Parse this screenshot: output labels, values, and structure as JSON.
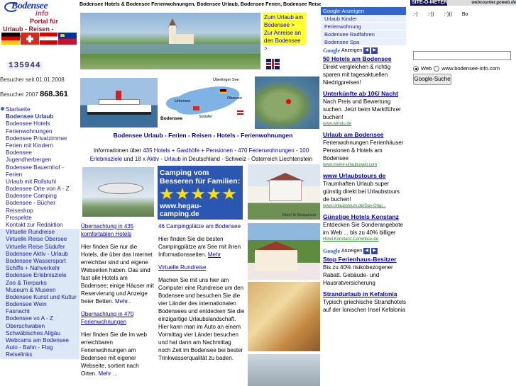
{
  "logo": {
    "line1": "Bodensee",
    "line2": "info",
    "line3": "Portal für",
    "line4": "Urlaub - Reisen - Freizeit"
  },
  "counter": "135944",
  "visitors_since": "Besucher seit 01.01.2008",
  "visitors_2007_label": "Besucher 2007",
  "visitors_2007_value": "868.361",
  "nav": [
    {
      "label": "Startseite",
      "bullet": true
    },
    {
      "label": "Bodensee Urlaub",
      "current": true
    },
    {
      "label": "Bodensee Hotels"
    },
    {
      "label": "Ferienwohnungen"
    },
    {
      "label": "Bodensee Privatzimmer"
    },
    {
      "label": "Ferien mit Kindern"
    },
    {
      "label": "Bodensee"
    },
    {
      "label": "Jugendherbergen"
    },
    {
      "label": "Bodensee Bauernhof -"
    },
    {
      "label": "  Ferien"
    },
    {
      "label": "Urlaub mit Rollstuhl"
    },
    {
      "label": "Bodensee Orte von A - Z"
    },
    {
      "label": "Bodensee Camping"
    },
    {
      "label": "Bodensee - Bücher"
    },
    {
      "label": "Reiseshop"
    },
    {
      "label": "Prospekte"
    },
    {
      "label": "Kontakt zur Redaktion"
    },
    {
      "label": "Virtuelle Rundreise",
      "alt": true
    },
    {
      "label": "Virtuelle Reise Obersee",
      "alt": true
    },
    {
      "label": "Virtuelle Reise Südufer",
      "alt": true
    },
    {
      "label": "Bodensee Aktiv - Urlaub",
      "alt": true
    },
    {
      "label": "Bodensee Wassersport",
      "alt": true
    },
    {
      "label": "Schiffe + Nahverkehr",
      "alt": true
    },
    {
      "label": "Bodensee Erlebnisziele",
      "alt": true
    },
    {
      "label": "Zoo & Tierparks",
      "alt": true
    },
    {
      "label": "Museum & Museen",
      "alt": true
    },
    {
      "label": "Bodensee Kunst und Kultur",
      "alt": true
    },
    {
      "label": "Bodensee Wein",
      "alt": true
    },
    {
      "label": "Fasnacht",
      "alt": true
    },
    {
      "label": "Bodensee vo A - Z",
      "alt": true
    },
    {
      "label": "Oberschwaben",
      "alt": true
    },
    {
      "label": "Schwäbisches Allgäu",
      "alt": true
    },
    {
      "label": "Webcams am Bodensee",
      "alt": true
    },
    {
      "label": "Auto - Bahn - Flug",
      "alt": true
    },
    {
      "label": "Reiselinks",
      "alt": true
    }
  ],
  "top_keywords": "Bodensee Hotels & Bodensee Ferienwohnungen, Bodensee Urlaub, Bodensee Ferien, Bodensee Reisen,",
  "yellow_box": {
    "a": "Zum Urlaub am Bodensee >",
    "b": "Zur Anreise an den Bodensee >"
  },
  "map_labels": {
    "ueberlinger": "Überlinger See",
    "obersee": "Obersee",
    "untersee": "Untersee",
    "suedufer": "Südufer",
    "bodensee": "Bodensee"
  },
  "tagline": "Bodensee Urlaub - Ferien - Reisen - Hotels - Ferienwohnungen",
  "intro": {
    "pre": "Informationen über",
    "link1": "435 Hotels + Gasthöfe + Pensionen - 470 Ferienwohnungen - 100 Erlebnisziele",
    "mid": "und",
    "link2": "18 x Aktiv - Urlaub",
    "post": "in Deutschland - Schweiz - Österreich Liechtenstein"
  },
  "camping_ad": {
    "headline": "Camping vom Besseren für Familien:",
    "url": "www.hegau-camping.de",
    "stars": 5
  },
  "col1": {
    "h1": "Übernachtung in 435 komfortablen Hotels",
    "t1": "Hier finden Sie nur die Hotels, die über das Internet erreichbar sind und eigene Webseiten haben. Das sind fast alle Hotels am Bodensee; einige Häuser mit Reservierung und Anzeige freier Betten.",
    "more1": "Mehr..",
    "h2": "Übernachtung in 470 Ferienwohnungen",
    "t2": "Hier finden Sie die im web erreichbaren Ferienwohnungen am Bodensee mit eigener Webseite, sortiert nach Orten.",
    "more2": "Mehr ..."
  },
  "col2": {
    "h1": "46 Campingplätze am Bodensee",
    "t1": "Hier finden Sie die besten Campingplätze am See mit ihren Informationsseiten.",
    "more1": "Mehr",
    "h2": "Virtuelle Rundreise",
    "t2": "Machen Sie mit uns hier am Computer eine Rundreise um den Bodensee und besuchen Sie die vier Länder des internationalen Bodensees und entdecken Sie die einzigartige Urlaubslandschaft. Hier kann man im Auto an einem Vormittag vier Länder besuchen und hat dann am Nachmittag noch Zeit im Bodensee bei bester Trinkwasserqualität zu baden."
  },
  "hotel_photo_caption": "Hotel & Restaurant",
  "google": {
    "header": "Google-Anzeigen",
    "links": [
      "Urlaub Kinder",
      "Ferienwohnung",
      "Bodensee Radfahren",
      "Bodensee Spa"
    ],
    "mark_text": "Anzeigen",
    "ads": [
      {
        "title": "50 Hotels am Bodensee",
        "desc": "Direkt vergleichen & richtig sparen mit tagesaktuellen Niedrigpreisen!",
        "url": ""
      },
      {
        "title": "Unterkünfte ab 10€/ Nacht",
        "desc": "Nach Preis und Bewertung suchen. Jetzt beim Marktführer buchen!",
        "url": "www.wimdu.de"
      },
      {
        "title": "Urlaub am Bodensee",
        "desc": "Ferienwohnungen Ferienhäuser Pensionen & Hotels am Bodensee",
        "url": "www.meine-urlaubswelt.com"
      },
      {
        "title": "www Urlaubstours de",
        "desc": "Traumhaften Urlaub super günstig direkt bei Urlaubstours de buchen!",
        "url": "www.Urlaubstours.de/Das-Origi..."
      },
      {
        "title": "Günstige Hotels Konstanz",
        "desc": "Entdecken Sie Sonderangebote im Web ... bis zu 40% billiger",
        "url": "Hotel.Konstanz.Commbox.de"
      }
    ],
    "ads2": [
      {
        "title": "Stop Ferienhaus-Besitzer",
        "desc": "Bis zu 40% risikobezogener Rabatt. Gebäude- und Hausratversicherung",
        "url": ""
      },
      {
        "title": "Strandurlaub in Kefalonia",
        "desc": "Typisch griechische Strandhotels auf der Ionischen Insel Kefalonia",
        "url": ""
      }
    ]
  },
  "sitemeter": {
    "brand": "SITE-O-METER",
    "webcounter": "webcounter.goweb.de",
    "smileys": [
      ":-)",
      ":-))",
      ":-)))",
      "Bo"
    ]
  },
  "search": {
    "web_label": "Web",
    "site_label": "www.bodensee-info.com",
    "button": "Google-Suche"
  }
}
